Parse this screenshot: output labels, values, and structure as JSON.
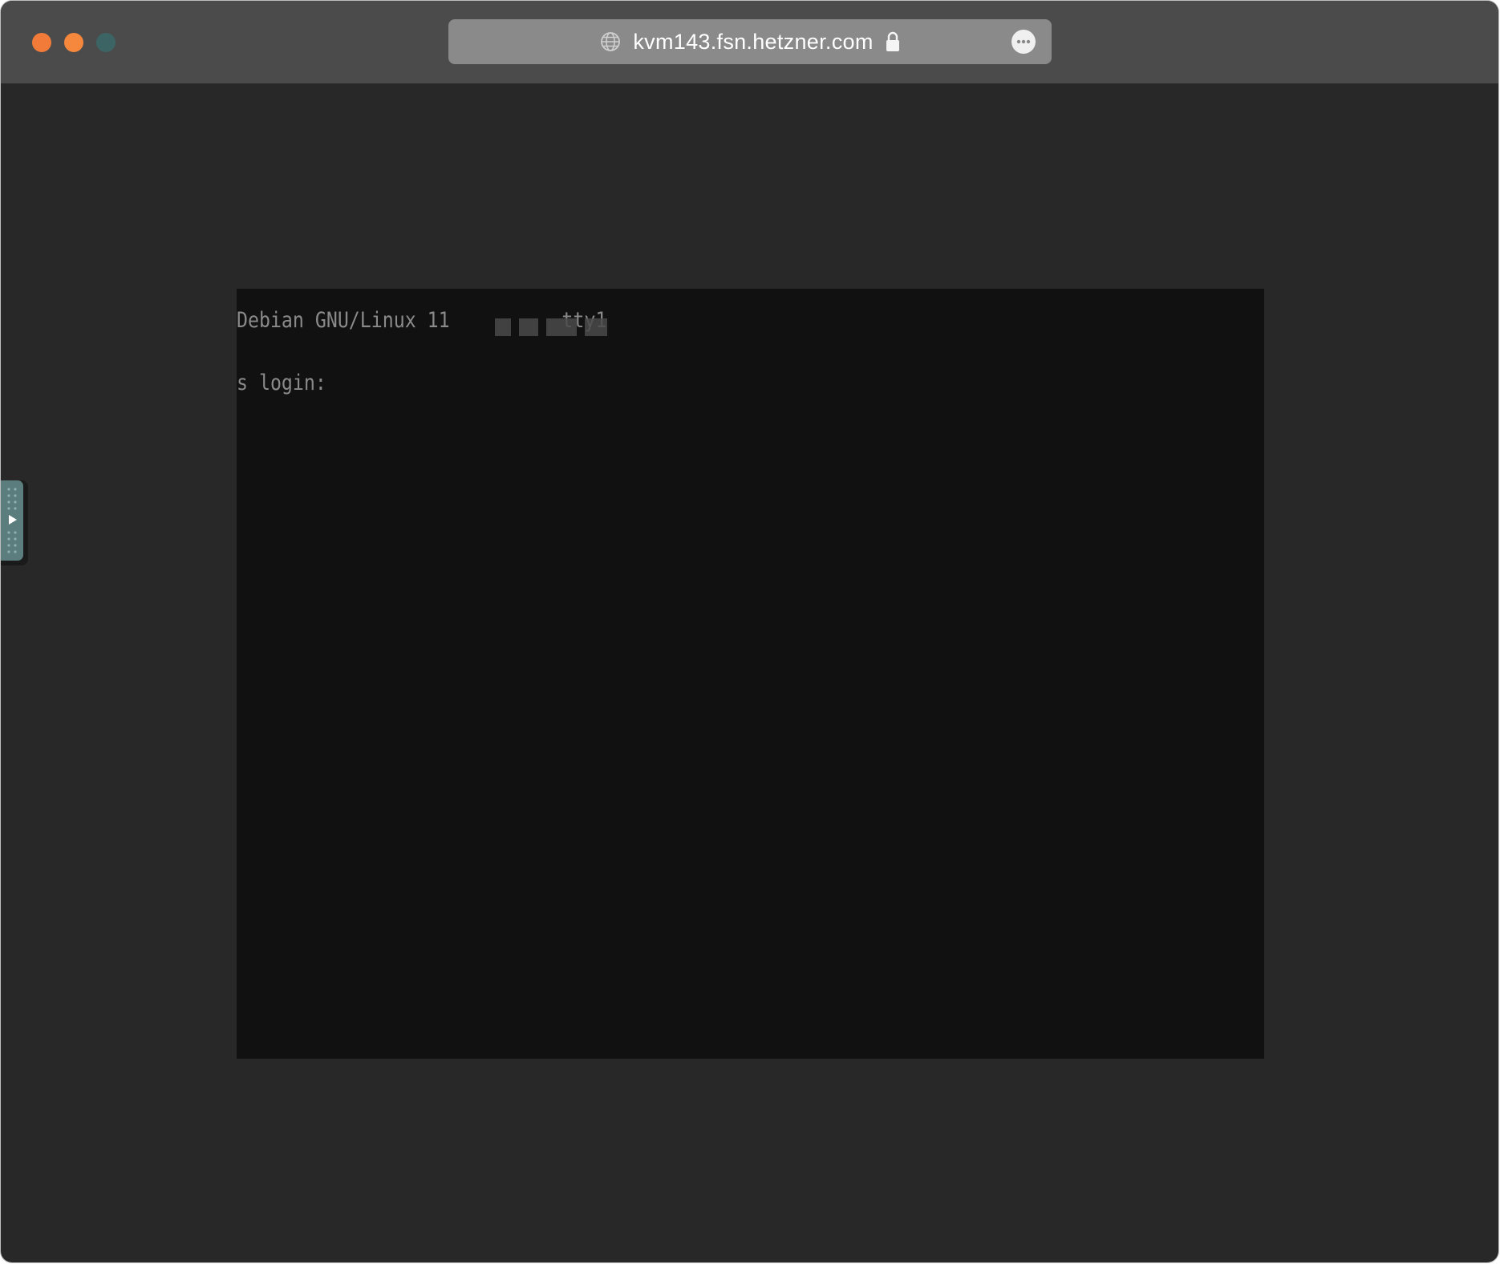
{
  "browser": {
    "url": "kvm143.fsn.hetzner.com",
    "icons": {
      "site": "globe-icon",
      "security": "lock-icon",
      "menu": "more-icon"
    }
  },
  "traffic_lights": {
    "close_color": "#f27b3a",
    "minimize_color": "#f5883c",
    "zoom_color": "#3d6464"
  },
  "console": {
    "line1_prefix": "Debian GNU/Linux 11",
    "line1_suffix": "tty1",
    "line2": "s login:",
    "background": "#111111",
    "text_color": "#8a8a8a"
  },
  "side_panel": {
    "toggle_icon": "play-icon",
    "accent": "#5c7d7d"
  }
}
